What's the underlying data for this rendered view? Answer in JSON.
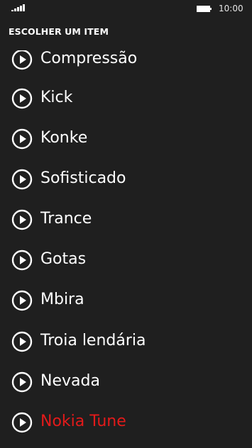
{
  "status_bar": {
    "time": "10:00",
    "signal_icon": "signal-strength-icon",
    "battery_icon": "battery-icon"
  },
  "page": {
    "title": "ESCOLHER UM ITEM"
  },
  "colors": {
    "background": "#1f1f1f",
    "text": "#ffffff",
    "selected_accent": "#e31a1a"
  },
  "items": [
    {
      "label": "Compressão",
      "selected": false
    },
    {
      "label": "Kick",
      "selected": false
    },
    {
      "label": "Konke",
      "selected": false
    },
    {
      "label": "Sofisticado",
      "selected": false
    },
    {
      "label": "Trance",
      "selected": false
    },
    {
      "label": "Gotas",
      "selected": false
    },
    {
      "label": "Mbira",
      "selected": false
    },
    {
      "label": "Troia lendária",
      "selected": false
    },
    {
      "label": "Nevada",
      "selected": false
    },
    {
      "label": "Nokia Tune",
      "selected": true
    }
  ]
}
